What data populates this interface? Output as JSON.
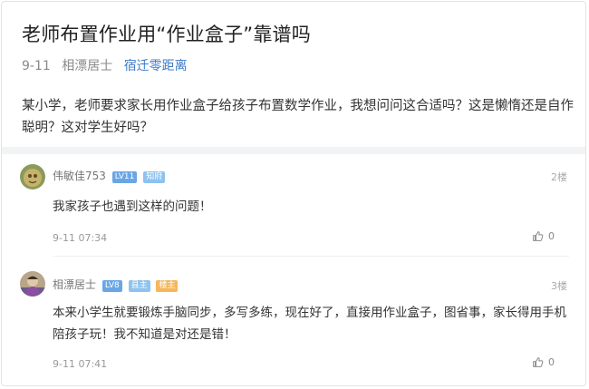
{
  "post": {
    "title": "老师布置作业用“作业盒子”靠谱吗",
    "date": "9-11",
    "author": "相漂居士",
    "forum": "宿迁零距离",
    "body": "某小学，老师要求家长用作业盒子给孩子布置数学作业，我想问问这合适吗？这是懒惰还是自作聪明？这对学生好吗？"
  },
  "replies": [
    {
      "username": "伟敏佳753",
      "badges": [
        {
          "text": "LV11",
          "color": "#6aa6e6"
        },
        {
          "text": "知府",
          "color": "#8ec3ef"
        }
      ],
      "floor": "2楼",
      "text": "我家孩子也遇到这样的问题！",
      "time": "9-11 07:34",
      "like": "0",
      "avatar_icon": "user-avatar"
    },
    {
      "username": "相漂居士",
      "badges": [
        {
          "text": "LV8",
          "color": "#6aa6e6"
        },
        {
          "text": "县主",
          "color": "#8ec3ef"
        },
        {
          "text": "楼主",
          "color": "#f5b75a"
        }
      ],
      "floor": "3楼",
      "text": "本来小学生就要锻炼手脑同步，多写多练，现在好了，直接用作业盒子，图省事，家长得用手机陪孩子玩！我不知道是对还是错！",
      "time": "9-11 07:41",
      "like": "0",
      "avatar_icon": "user-avatar"
    }
  ]
}
